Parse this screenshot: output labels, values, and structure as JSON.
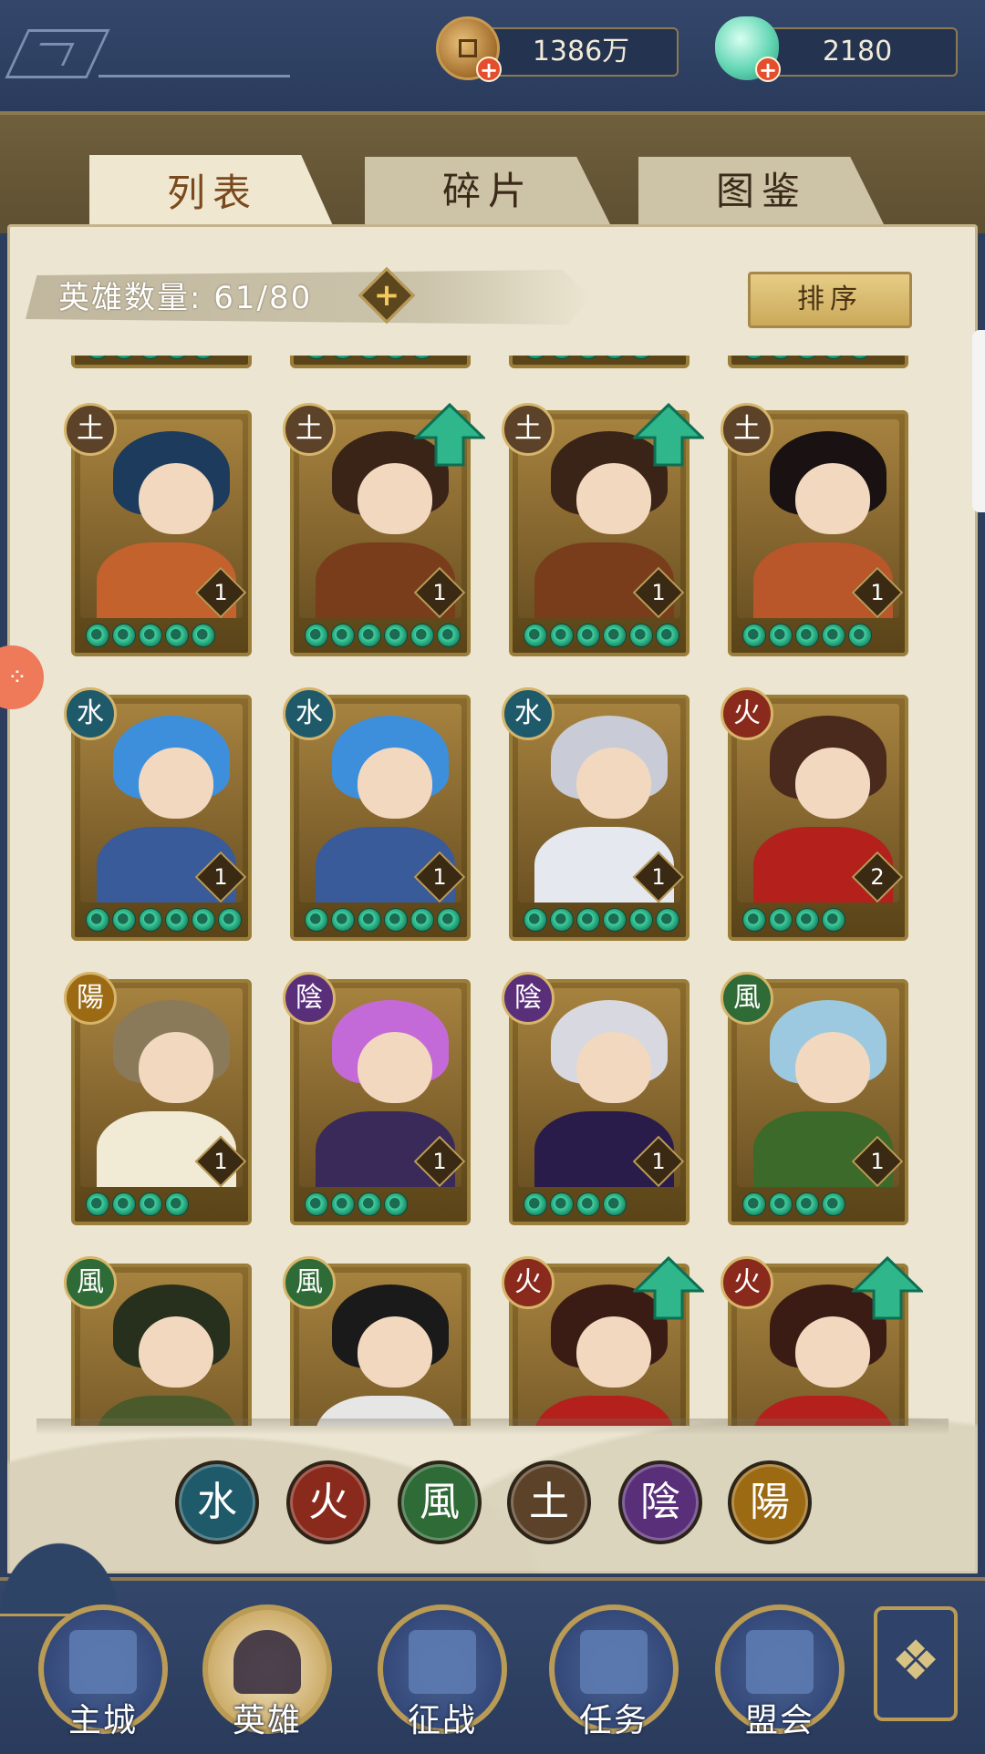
{
  "currencies": {
    "coins": {
      "value": "1386万",
      "icon": "coin-icon"
    },
    "gems": {
      "value": "2180",
      "icon": "gem-icon"
    }
  },
  "tabs": [
    {
      "label": "列表",
      "active": true
    },
    {
      "label": "碎片",
      "active": false
    },
    {
      "label": "图鉴",
      "active": false
    }
  ],
  "hero_count": {
    "label": "英雄数量:",
    "value": "61/80"
  },
  "sort_button": {
    "label": "排序"
  },
  "hero_rows": [
    [
      {
        "element": "土",
        "element_class": "e-earth",
        "level": "1",
        "stars": 5,
        "upgrade": false,
        "hair": "#1d3b5c",
        "outfit": "#c4622e"
      },
      {
        "element": "土",
        "element_class": "e-earth",
        "level": "1",
        "stars": 6,
        "upgrade": true,
        "hair": "#3a2418",
        "outfit": "#7a3d1c"
      },
      {
        "element": "土",
        "element_class": "e-earth",
        "level": "1",
        "stars": 6,
        "upgrade": true,
        "hair": "#3a2418",
        "outfit": "#7a3d1c"
      },
      {
        "element": "土",
        "element_class": "e-earth",
        "level": "1",
        "stars": 5,
        "upgrade": false,
        "hair": "#1a1212",
        "outfit": "#b9562a"
      }
    ],
    [
      {
        "element": "水",
        "element_class": "e-water",
        "level": "1",
        "stars": 6,
        "upgrade": false,
        "hair": "#3d8fdc",
        "outfit": "#3a5b9a"
      },
      {
        "element": "水",
        "element_class": "e-water",
        "level": "1",
        "stars": 6,
        "upgrade": false,
        "hair": "#3d8fdc",
        "outfit": "#3a5b9a"
      },
      {
        "element": "水",
        "element_class": "e-water",
        "level": "1",
        "stars": 6,
        "upgrade": false,
        "hair": "#c9ccd6",
        "outfit": "#e6e8ef"
      },
      {
        "element": "火",
        "element_class": "e-fire",
        "level": "2",
        "stars": 4,
        "upgrade": false,
        "hair": "#4a2a1c",
        "outfit": "#b4201c"
      }
    ],
    [
      {
        "element": "陽",
        "element_class": "e-yang",
        "level": "1",
        "stars": 4,
        "upgrade": false,
        "hair": "#8a7a5a",
        "outfit": "#f1ead4"
      },
      {
        "element": "陰",
        "element_class": "e-yin",
        "level": "1",
        "stars": 4,
        "upgrade": false,
        "hair": "#c46ad8",
        "outfit": "#3a2a5a"
      },
      {
        "element": "陰",
        "element_class": "e-yin",
        "level": "1",
        "stars": 4,
        "upgrade": false,
        "hair": "#d8d8e0",
        "outfit": "#2a1c4a"
      },
      {
        "element": "風",
        "element_class": "e-wood",
        "level": "1",
        "stars": 4,
        "upgrade": false,
        "hair": "#9cc8e0",
        "outfit": "#3c6a2a"
      }
    ],
    [
      {
        "element": "風",
        "element_class": "e-wood",
        "level": "",
        "stars": 0,
        "upgrade": false,
        "hair": "#26301c",
        "outfit": "#4a5a2a"
      },
      {
        "element": "風",
        "element_class": "e-wood",
        "level": "",
        "stars": 0,
        "upgrade": false,
        "hair": "#1a1a1a",
        "outfit": "#e6e6e6"
      },
      {
        "element": "火",
        "element_class": "e-fire",
        "level": "",
        "stars": 0,
        "upgrade": true,
        "hair": "#3a1c14",
        "outfit": "#b4201c"
      },
      {
        "element": "火",
        "element_class": "e-fire",
        "level": "",
        "stars": 0,
        "upgrade": true,
        "hair": "#3a1c14",
        "outfit": "#b4201c"
      }
    ]
  ],
  "element_filters": [
    {
      "label": "水",
      "element_class": "e-water"
    },
    {
      "label": "火",
      "element_class": "e-fire"
    },
    {
      "label": "風",
      "element_class": "e-wood"
    },
    {
      "label": "土",
      "element_class": "e-earth"
    },
    {
      "label": "陰",
      "element_class": "e-yin"
    },
    {
      "label": "陽",
      "element_class": "e-yang"
    }
  ],
  "bottom_nav": [
    {
      "label": "主城",
      "icon": "city-icon",
      "active": false
    },
    {
      "label": "英雄",
      "icon": "hero-icon",
      "active": true
    },
    {
      "label": "征战",
      "icon": "battle-icon",
      "active": false
    },
    {
      "label": "任务",
      "icon": "quest-icon",
      "active": false
    },
    {
      "label": "盟会",
      "icon": "guild-icon",
      "active": false
    }
  ],
  "menu_icon": "menu-icon",
  "colors": {
    "accent_gold": "#b99b56",
    "panel_bg": "#ebe5d1",
    "nav_bg": "#2c3d5e",
    "star_teal": "#3fd1a0"
  }
}
